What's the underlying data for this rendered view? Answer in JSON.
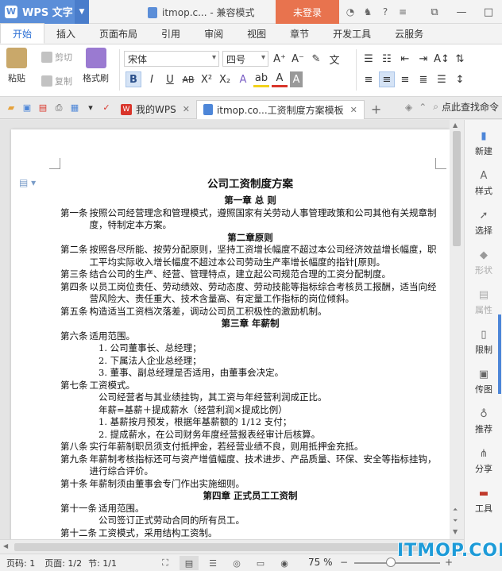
{
  "titlebar": {
    "app_name": "WPS 文字",
    "doc_title": "itmop.c... - 兼容模式",
    "login_label": "未登录"
  },
  "menu": {
    "tabs": [
      "开始",
      "插入",
      "页面布局",
      "引用",
      "审阅",
      "视图",
      "章节",
      "开发工具",
      "云服务"
    ],
    "active": "开始"
  },
  "ribbon": {
    "paste_label": "粘贴",
    "cut_label": "剪切",
    "copy_label": "复制",
    "format_painter_label": "格式刷",
    "font_name": "宋体",
    "font_size": "四号"
  },
  "docbar": {
    "tabs": [
      {
        "label": "我的WPS",
        "icon": "wps-icon"
      },
      {
        "label": "itmop.co...工资制度方案模板",
        "icon": "doc-icon"
      }
    ],
    "search_label": "点此查找命令"
  },
  "document": {
    "title": "公司工资制度方案",
    "chapter1": "第一章 总 则",
    "a1_n": "第一条",
    "a1_t": "按照公司经营理念和管理模式，遵照国家有关劳动人事管理政策和公司其他有关规章制度，特制定本方案。",
    "chapter2": "第二章原则",
    "a2_n": "第二条",
    "a2_t": "按照各尽所能、按劳分配原则，坚持工资增长幅度不超过本公司经济效益增长幅度，职工平均实际收入增长幅度不超过本公司劳动生产率增长幅度的指针[原则。",
    "a3_n": "第三条",
    "a3_t": "结合公司的生产、经营、管理特点，建立起公司规范合理的工资分配制度。",
    "a4_n": "第四条",
    "a4_t": "以员工岗位责任、劳动绩效、劳动态度、劳动技能等指标综合考核员工报酬，适当向经营风险大、责任重大、技术含量高、有定量工作指标的岗位倾斜。",
    "a5_n": "第五条",
    "a5_t": "构造适当工资档次落差，调动公司员工积极性的激励机制。",
    "chapter3": "第三章 年薪制",
    "a6_n": "第六条",
    "a6_t": "适用范围。",
    "a6_l1": "1.  公司董事长、总经理；",
    "a6_l2": "2.  下属法人企业总经理；",
    "a6_l3": "3.  董事、副总经理是否适用，由董事会决定。",
    "a7_n": "第七条",
    "a7_t": "工资模式。",
    "a7_p1": "公司经营者与其业绩挂钩，其工资与年经营利润成正比。",
    "a7_p2": "年薪=基薪＋提成薪水（经营利润×提成比例）",
    "a7_l1": "1.  基薪按月预发，根据年基薪额的 1/12 支付；",
    "a7_l2": "2.  提成薪水，在公司财务年度经营报表经审计后核算。",
    "a8_n": "第八条",
    "a8_t": "实行年薪制职员须支付抵押金，若经营业绩不良，则用抵押金充抵。",
    "a9_n": "第九条",
    "a9_t": "年薪制考核指标还可与资产增值幅度、技术进步、产品质量、环保、安全等指标挂钩，进行综合评价。",
    "a10_n": "第十条",
    "a10_t": "年薪制须由董事会专门作出实施细则。",
    "chapter4": "第四章 正式员工工资制",
    "a11_n": "第十一条",
    "a11_t": "适用范围。",
    "a11_p1": "公司签订正式劳动合同的所有员工。",
    "a12_n": "第十二条",
    "a12_t": "工资模式，采用结构工资制。"
  },
  "rpanel": {
    "items": [
      "新建",
      "样式",
      "选择",
      "形状",
      "属性",
      "限制",
      "传图",
      "推荐",
      "分享",
      "工具"
    ]
  },
  "status": {
    "page_count": "页码: 1",
    "pages": "页面: 1/2",
    "section": "节: 1/1",
    "zoom": "75 %"
  },
  "watermark": "ITMOP.COM"
}
